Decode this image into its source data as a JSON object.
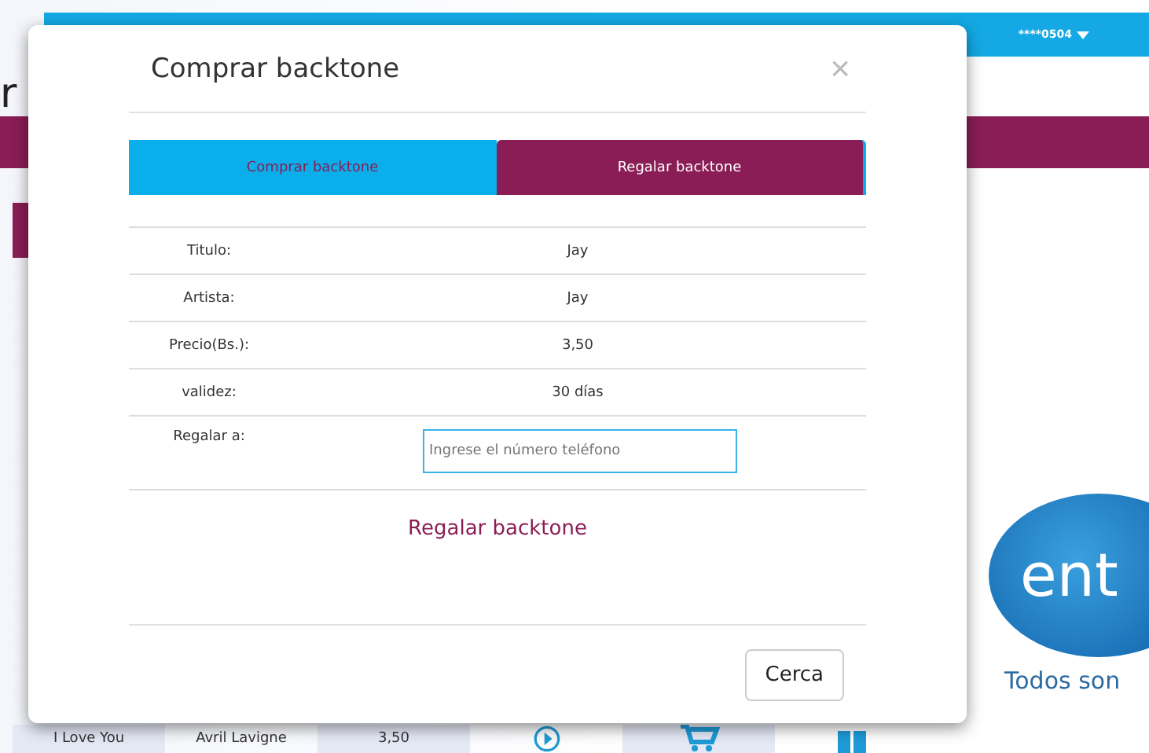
{
  "header": {
    "account": "****0504"
  },
  "page_fragment": "r",
  "logo": {
    "text": "ent",
    "tagline": "Todos son"
  },
  "background_row": {
    "cells": [
      "I Love You",
      "Avril Lavigne",
      "3,50"
    ]
  },
  "dialog": {
    "title": "Comprar backtone",
    "close": "×",
    "tabs": [
      {
        "label": "Comprar backtone",
        "selected": false
      },
      {
        "label": "Regalar backtone",
        "selected": true
      }
    ],
    "details": [
      {
        "label": "Titulo:",
        "value": "Jay"
      },
      {
        "label": "Artista:",
        "value": "Jay"
      },
      {
        "label": "Precio(Bs.):",
        "value": "3,50"
      },
      {
        "label": "validez:",
        "value": "30 días"
      }
    ],
    "gift": {
      "label": "Regalar a:",
      "placeholder": "Ingrese el número teléfono"
    },
    "action": "Regalar backtone",
    "close_button": "Cerca"
  }
}
